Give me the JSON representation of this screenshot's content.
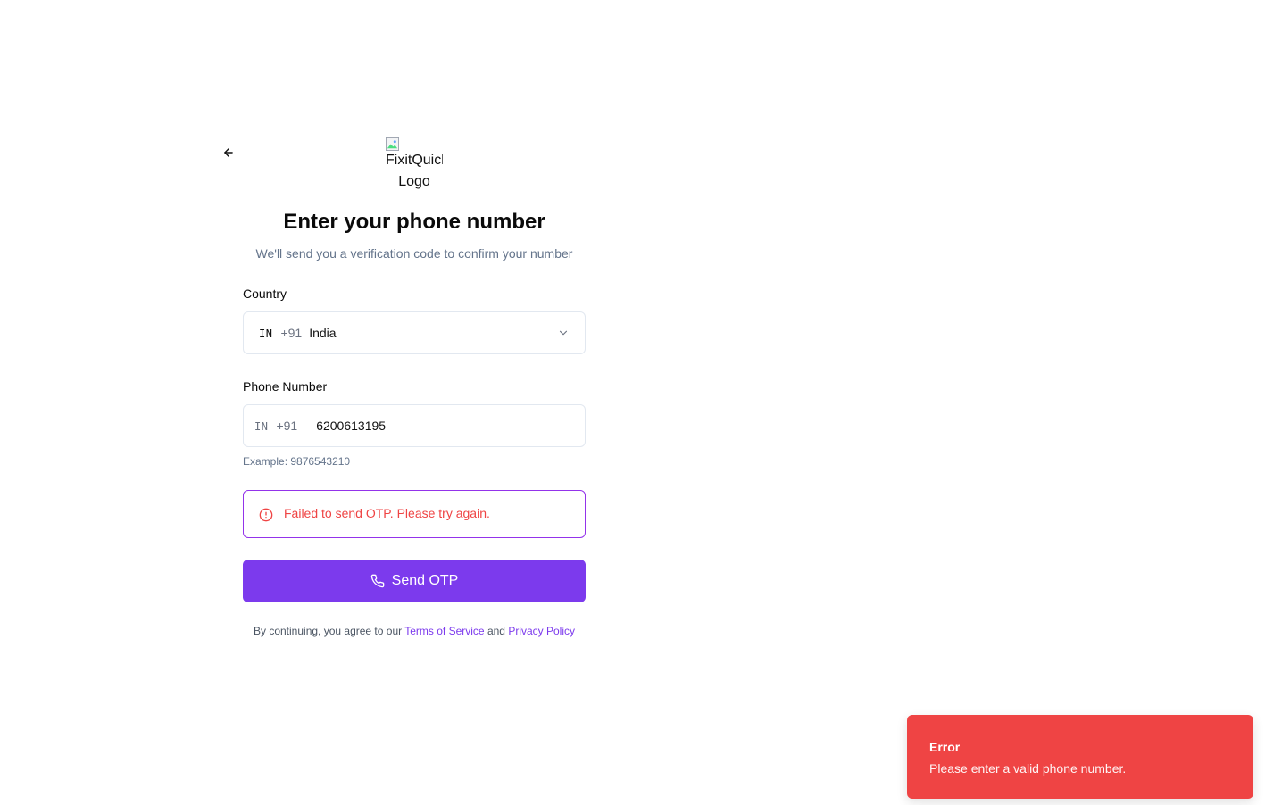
{
  "header": {
    "logo_alt": "FixitQuick Logo",
    "icons": {
      "back": "arrow-left-icon",
      "logo": "broken-image-icon"
    }
  },
  "main": {
    "title": "Enter your phone number",
    "subtitle": "We'll send you a verification code to confirm your number",
    "country": {
      "label": "Country",
      "code": "IN",
      "dial_code": "+91",
      "name": "India",
      "icon": "chevron-down-icon"
    },
    "phone": {
      "label": "Phone Number",
      "code": "IN",
      "dial_code": "+91",
      "value": "6200613195",
      "helper": "Example: 9876543210"
    },
    "alert": {
      "text": "Failed to send OTP. Please try again.",
      "icon": "alert-circle-icon",
      "color": "#ef4444",
      "border_color": "#9333ea"
    },
    "submit": {
      "label": "Send OTP",
      "icon": "phone-icon",
      "color": "#7c3aed"
    },
    "terms": {
      "prefix": "By continuing, you agree to our",
      "terms_link": "Terms of Service",
      "joiner": "and",
      "privacy_link": "Privacy Policy"
    }
  },
  "toast": {
    "title": "Error",
    "message": "Please enter a valid phone number.",
    "color": "#ef4444"
  }
}
